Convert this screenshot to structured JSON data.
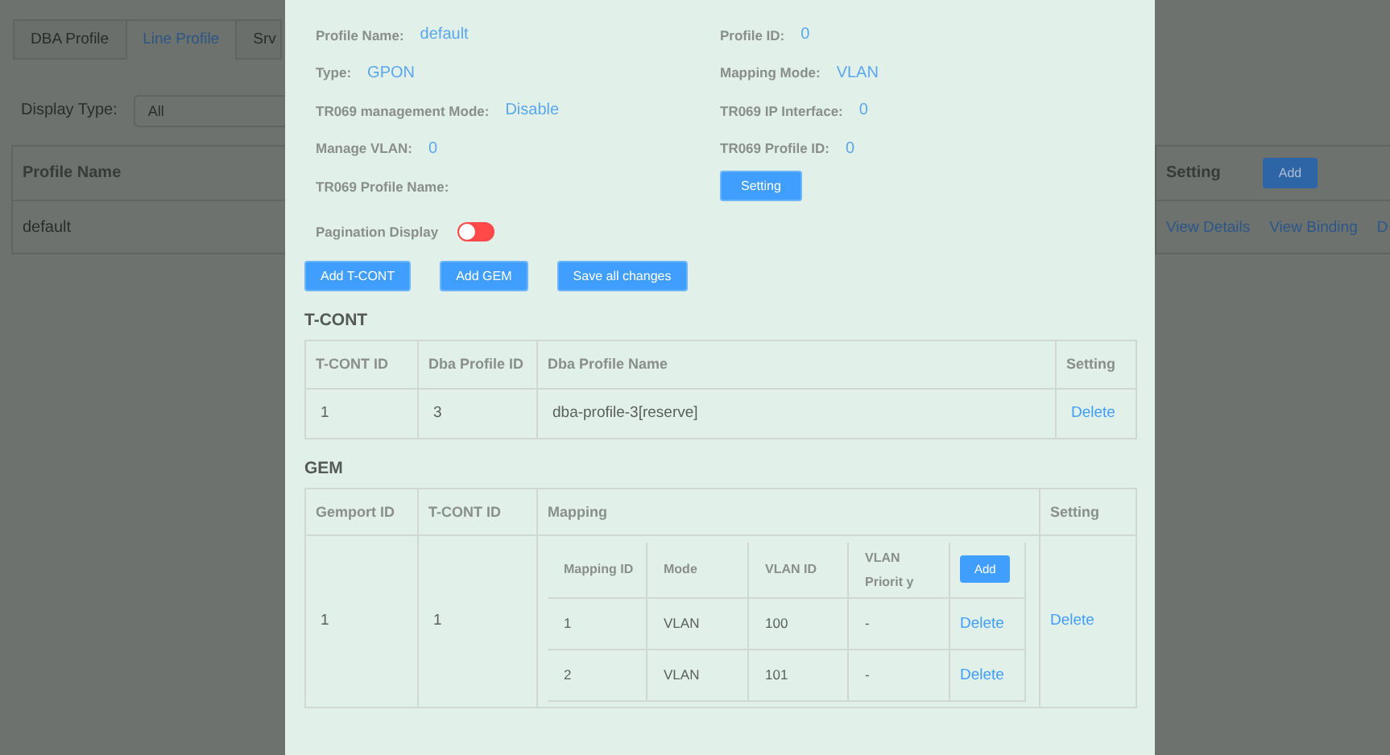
{
  "background": {
    "tabs": [
      {
        "label": "DBA Profile",
        "selected": false
      },
      {
        "label": "Line Profile",
        "selected": true
      },
      {
        "label": "Srv",
        "selected": false
      }
    ],
    "display_type": {
      "label": "Display Type:",
      "value": "All"
    },
    "table": {
      "column_1": "Profile Name",
      "setting_header": "Setting",
      "add_button": "Add",
      "rows": [
        {
          "name": "default",
          "actions": [
            "View Details",
            "View Binding",
            "D"
          ]
        }
      ]
    }
  },
  "dialog": {
    "info_left": [
      {
        "label": "Profile Name:",
        "value": "default"
      },
      {
        "label": "Type:",
        "value": "GPON"
      },
      {
        "label": "TR069 management Mode:",
        "value": "Disable"
      },
      {
        "label": "Manage VLAN:",
        "value": "0"
      },
      {
        "label": "TR069 Profile Name:"
      }
    ],
    "info_right": [
      {
        "label": "Profile ID:",
        "value": "0"
      },
      {
        "label": "Mapping Mode:",
        "value": "VLAN"
      },
      {
        "label": "TR069 IP Interface:",
        "value": "0"
      },
      {
        "label": "TR069 Profile ID:",
        "value": "0"
      }
    ],
    "setting_button": "Setting",
    "pagination": {
      "label": "Pagination Display",
      "on": false
    },
    "actions": [
      "Add T-CONT",
      "Add GEM",
      "Save all changes"
    ],
    "tcont": {
      "title": "T-CONT",
      "columns": [
        "T-CONT ID",
        "Dba Profile ID",
        "Dba Profile Name",
        "Setting"
      ],
      "rows": [
        {
          "cells": [
            "1",
            "3",
            "dba-profile-3[reserve]"
          ],
          "action": "Delete"
        }
      ]
    },
    "gem": {
      "title": "GEM",
      "columns": [
        "Gemport ID",
        "T-CONT ID",
        "Mapping",
        "Setting"
      ],
      "rows": [
        {
          "gemport_id": "1",
          "tcont_id": "1",
          "action": "Delete",
          "mapping": {
            "columns": [
              "Mapping ID",
              "Mode",
              "VLAN ID",
              "VLAN Priorit y"
            ],
            "add_button": "Add",
            "rows": [
              {
                "cells": [
                  "1",
                  "VLAN",
                  "100",
                  "-"
                ],
                "action": "Delete"
              },
              {
                "cells": [
                  "2",
                  "VLAN",
                  "101",
                  "-"
                ],
                "action": "Delete"
              }
            ]
          }
        }
      ]
    }
  }
}
